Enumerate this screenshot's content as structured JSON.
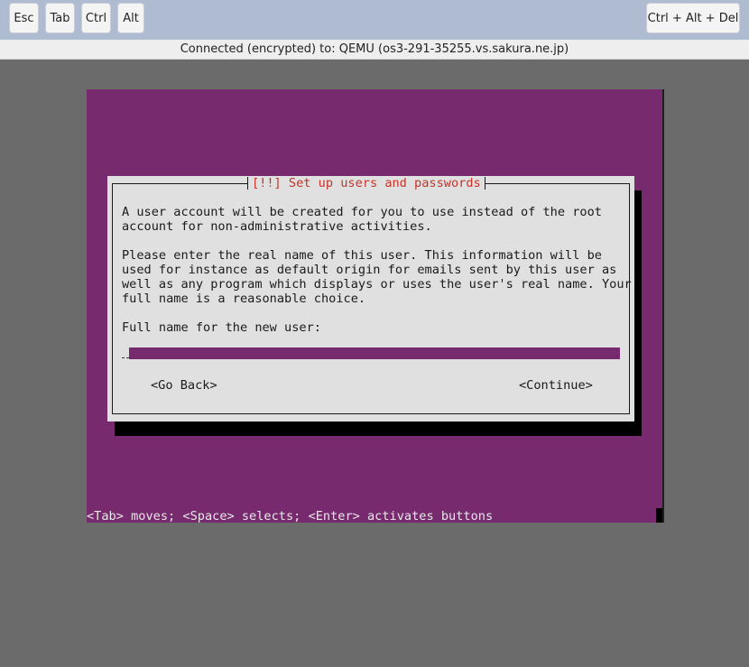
{
  "toolbar": {
    "keys": {
      "esc": "Esc",
      "tab": "Tab",
      "ctrl": "Ctrl",
      "alt": "Alt",
      "ctrl_alt_del": "Ctrl + Alt + Del"
    },
    "connection_status": "Connected (encrypted) to: QEMU (os3-291-35255.vs.sakura.ne.jp)"
  },
  "console": {
    "dialog": {
      "title": "[!!] Set up users and passwords",
      "paragraph_1": "A user account will be created for you to use instead of the root\naccount for non-administrative activities.",
      "paragraph_2": "Please enter the real name of this user. This information will be\nused for instance as default origin for emails sent by this user as\nwell as any program which displays or uses the user's real name. Your\nfull name is a reasonable choice.",
      "field_label": "Full name for the new user:",
      "full_name_value": "",
      "go_back_label": "<Go Back>",
      "continue_label": "<Continue>"
    },
    "help_text": "<Tab> moves; <Space> selects; <Enter> activates buttons"
  },
  "colors": {
    "console_background": "#782a6e",
    "dialog_background": "#e0e0e0",
    "dialog_title": "#c4332a",
    "toolbar_background": "#aebbd0",
    "page_background": "#6b6b6b"
  }
}
